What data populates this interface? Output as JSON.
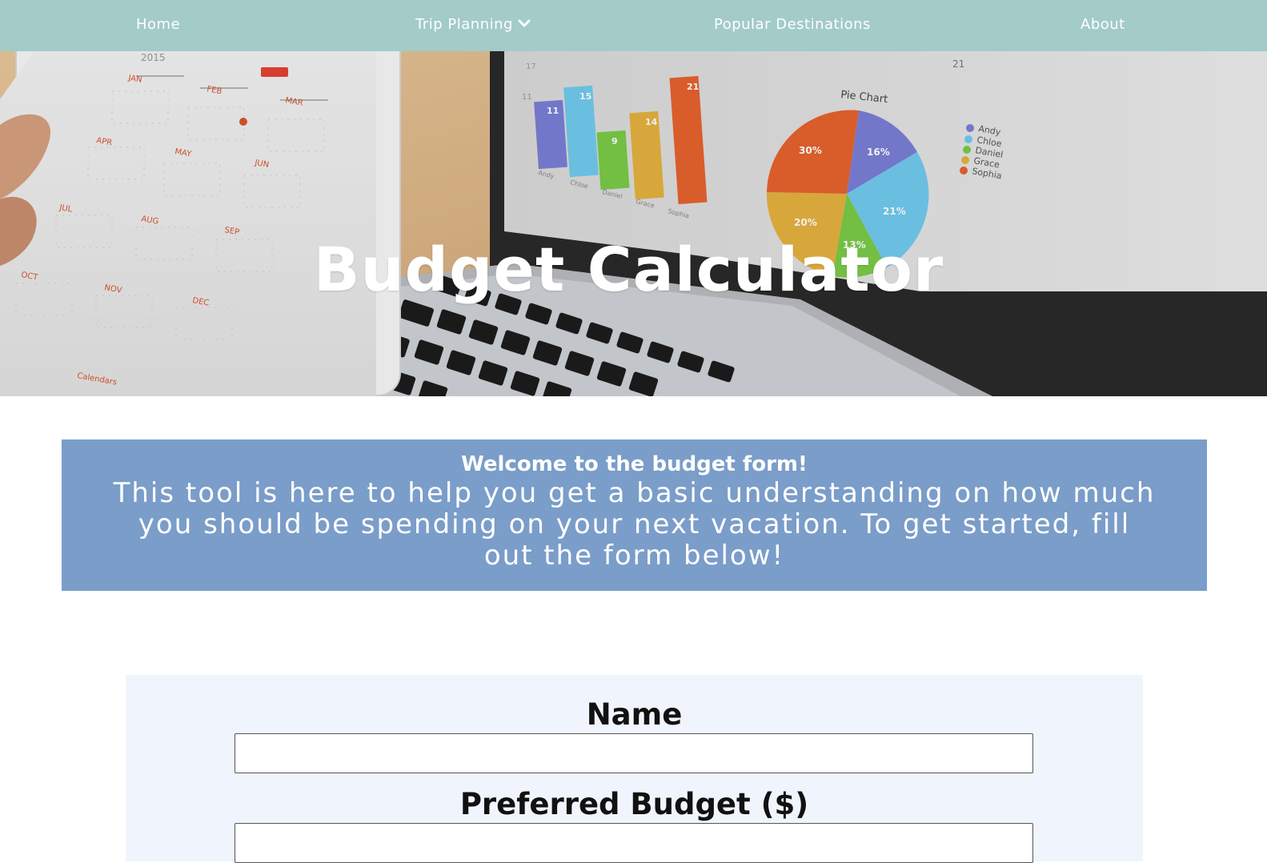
{
  "nav": {
    "items": [
      {
        "label": "Home"
      },
      {
        "label": "Trip Planning"
      },
      {
        "label": "Popular Destinations"
      },
      {
        "label": "About"
      }
    ],
    "background": "#a3cbc8"
  },
  "hero": {
    "title": "Budget Calculator",
    "illustration": {
      "calendar_months": [
        "JAN",
        "FEB",
        "MAR",
        "APR",
        "MAY",
        "JUN",
        "JUL",
        "AUG",
        "SEP",
        "OCT",
        "NOV",
        "DEC"
      ],
      "calendar_year": "2015",
      "calendar_footer": "Calendars",
      "bar_values": [
        "11",
        "15",
        "9",
        "14",
        "21"
      ],
      "bar_names": [
        "Andy",
        "Chloe",
        "Daniel",
        "Grace",
        "Sophia"
      ],
      "pie_title": "Pie Chart",
      "pie_labels": [
        "16%",
        "21%",
        "13%",
        "20%",
        "30%"
      ],
      "legend": [
        "Andy",
        "Chloe",
        "Daniel",
        "Grace",
        "Sophia"
      ],
      "axis_top_label": "21"
    }
  },
  "banner": {
    "title": "Welcome to the budget form!",
    "text": "This tool is here to help you get a basic understanding on how much you should be spending on your next vacation. To get started, fill out the form below!",
    "background": "#7a9dc9"
  },
  "form": {
    "name_label": "Name",
    "name_value": "",
    "budget_label": "Preferred Budget ($)",
    "budget_value": "",
    "background": "#f0f5fd"
  }
}
